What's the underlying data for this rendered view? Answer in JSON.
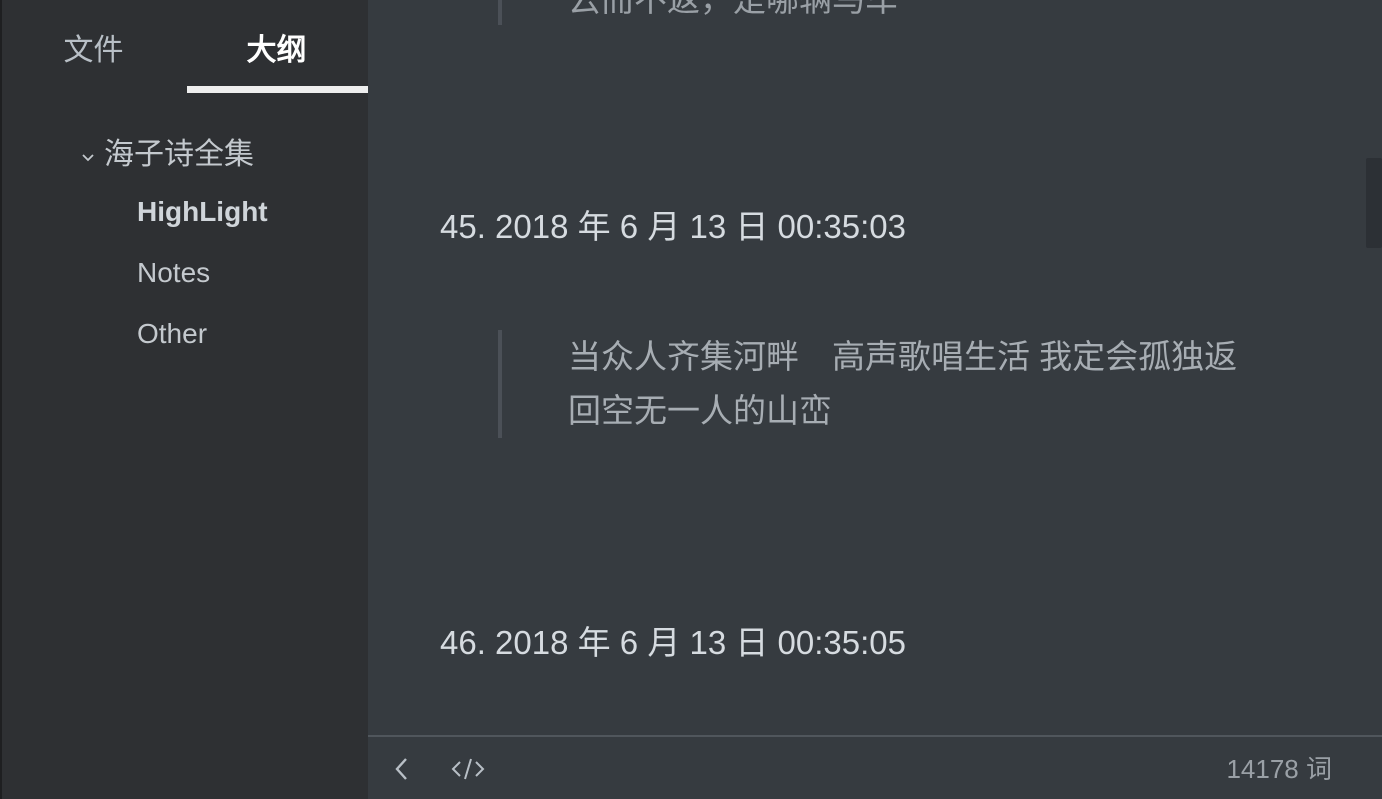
{
  "sidebar": {
    "tabs": [
      {
        "label": "文件",
        "active": false
      },
      {
        "label": "大纲",
        "active": true
      }
    ],
    "outline": {
      "root": {
        "label": "海子诗全集",
        "expanded": true,
        "icon": "chevron-down-icon"
      },
      "children": [
        {
          "label": "HighLight",
          "active": true
        },
        {
          "label": "Notes",
          "active": false
        },
        {
          "label": "Other",
          "active": false
        }
      ]
    }
  },
  "editor": {
    "top_quote_text": "云而不返，是哪辆马车",
    "entries": [
      {
        "heading": "45. 2018 年 6 月 13 日 00:35:03"
      },
      {
        "heading": "46. 2018 年 6 月 13 日 00:35:05"
      }
    ],
    "quote_lines": [
      "当众人齐集河畔　高声歌唱生活 我定会孤独返",
      "回空无一人的山峦"
    ]
  },
  "footer": {
    "back_icon": "chevron-left-icon",
    "source_icon": "code-icon",
    "word_count": "14178 词"
  },
  "colors": {
    "sidebar_bg": "#2e3033",
    "editor_bg": "#363b40",
    "text": "#d6dbe0"
  }
}
